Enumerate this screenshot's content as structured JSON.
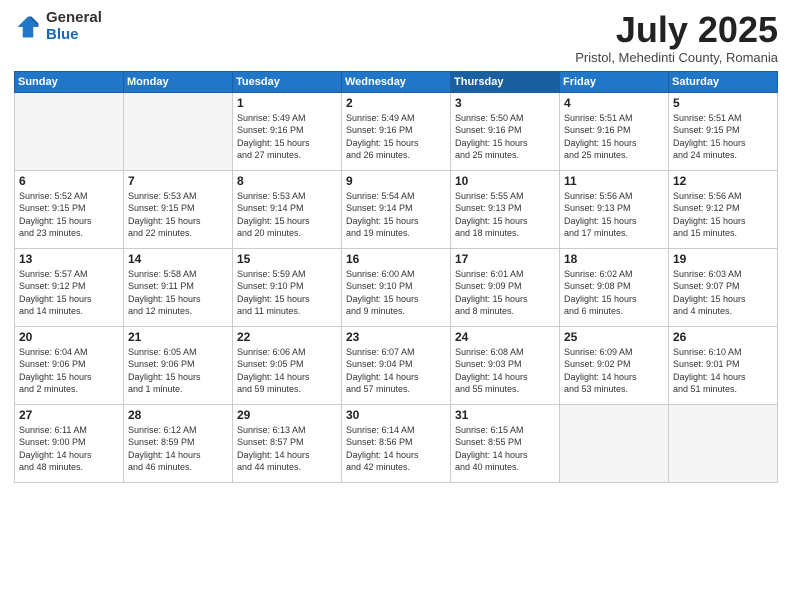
{
  "logo": {
    "general": "General",
    "blue": "Blue"
  },
  "header": {
    "month": "July 2025",
    "location": "Pristol, Mehedinti County, Romania"
  },
  "weekdays": [
    "Sunday",
    "Monday",
    "Tuesday",
    "Wednesday",
    "Thursday",
    "Friday",
    "Saturday"
  ],
  "weeks": [
    [
      {
        "day": "",
        "info": ""
      },
      {
        "day": "",
        "info": ""
      },
      {
        "day": "1",
        "info": "Sunrise: 5:49 AM\nSunset: 9:16 PM\nDaylight: 15 hours\nand 27 minutes."
      },
      {
        "day": "2",
        "info": "Sunrise: 5:49 AM\nSunset: 9:16 PM\nDaylight: 15 hours\nand 26 minutes."
      },
      {
        "day": "3",
        "info": "Sunrise: 5:50 AM\nSunset: 9:16 PM\nDaylight: 15 hours\nand 25 minutes."
      },
      {
        "day": "4",
        "info": "Sunrise: 5:51 AM\nSunset: 9:16 PM\nDaylight: 15 hours\nand 25 minutes."
      },
      {
        "day": "5",
        "info": "Sunrise: 5:51 AM\nSunset: 9:15 PM\nDaylight: 15 hours\nand 24 minutes."
      }
    ],
    [
      {
        "day": "6",
        "info": "Sunrise: 5:52 AM\nSunset: 9:15 PM\nDaylight: 15 hours\nand 23 minutes."
      },
      {
        "day": "7",
        "info": "Sunrise: 5:53 AM\nSunset: 9:15 PM\nDaylight: 15 hours\nand 22 minutes."
      },
      {
        "day": "8",
        "info": "Sunrise: 5:53 AM\nSunset: 9:14 PM\nDaylight: 15 hours\nand 20 minutes."
      },
      {
        "day": "9",
        "info": "Sunrise: 5:54 AM\nSunset: 9:14 PM\nDaylight: 15 hours\nand 19 minutes."
      },
      {
        "day": "10",
        "info": "Sunrise: 5:55 AM\nSunset: 9:13 PM\nDaylight: 15 hours\nand 18 minutes."
      },
      {
        "day": "11",
        "info": "Sunrise: 5:56 AM\nSunset: 9:13 PM\nDaylight: 15 hours\nand 17 minutes."
      },
      {
        "day": "12",
        "info": "Sunrise: 5:56 AM\nSunset: 9:12 PM\nDaylight: 15 hours\nand 15 minutes."
      }
    ],
    [
      {
        "day": "13",
        "info": "Sunrise: 5:57 AM\nSunset: 9:12 PM\nDaylight: 15 hours\nand 14 minutes."
      },
      {
        "day": "14",
        "info": "Sunrise: 5:58 AM\nSunset: 9:11 PM\nDaylight: 15 hours\nand 12 minutes."
      },
      {
        "day": "15",
        "info": "Sunrise: 5:59 AM\nSunset: 9:10 PM\nDaylight: 15 hours\nand 11 minutes."
      },
      {
        "day": "16",
        "info": "Sunrise: 6:00 AM\nSunset: 9:10 PM\nDaylight: 15 hours\nand 9 minutes."
      },
      {
        "day": "17",
        "info": "Sunrise: 6:01 AM\nSunset: 9:09 PM\nDaylight: 15 hours\nand 8 minutes."
      },
      {
        "day": "18",
        "info": "Sunrise: 6:02 AM\nSunset: 9:08 PM\nDaylight: 15 hours\nand 6 minutes."
      },
      {
        "day": "19",
        "info": "Sunrise: 6:03 AM\nSunset: 9:07 PM\nDaylight: 15 hours\nand 4 minutes."
      }
    ],
    [
      {
        "day": "20",
        "info": "Sunrise: 6:04 AM\nSunset: 9:06 PM\nDaylight: 15 hours\nand 2 minutes."
      },
      {
        "day": "21",
        "info": "Sunrise: 6:05 AM\nSunset: 9:06 PM\nDaylight: 15 hours\nand 1 minute."
      },
      {
        "day": "22",
        "info": "Sunrise: 6:06 AM\nSunset: 9:05 PM\nDaylight: 14 hours\nand 59 minutes."
      },
      {
        "day": "23",
        "info": "Sunrise: 6:07 AM\nSunset: 9:04 PM\nDaylight: 14 hours\nand 57 minutes."
      },
      {
        "day": "24",
        "info": "Sunrise: 6:08 AM\nSunset: 9:03 PM\nDaylight: 14 hours\nand 55 minutes."
      },
      {
        "day": "25",
        "info": "Sunrise: 6:09 AM\nSunset: 9:02 PM\nDaylight: 14 hours\nand 53 minutes."
      },
      {
        "day": "26",
        "info": "Sunrise: 6:10 AM\nSunset: 9:01 PM\nDaylight: 14 hours\nand 51 minutes."
      }
    ],
    [
      {
        "day": "27",
        "info": "Sunrise: 6:11 AM\nSunset: 9:00 PM\nDaylight: 14 hours\nand 48 minutes."
      },
      {
        "day": "28",
        "info": "Sunrise: 6:12 AM\nSunset: 8:59 PM\nDaylight: 14 hours\nand 46 minutes."
      },
      {
        "day": "29",
        "info": "Sunrise: 6:13 AM\nSunset: 8:57 PM\nDaylight: 14 hours\nand 44 minutes."
      },
      {
        "day": "30",
        "info": "Sunrise: 6:14 AM\nSunset: 8:56 PM\nDaylight: 14 hours\nand 42 minutes."
      },
      {
        "day": "31",
        "info": "Sunrise: 6:15 AM\nSunset: 8:55 PM\nDaylight: 14 hours\nand 40 minutes."
      },
      {
        "day": "",
        "info": ""
      },
      {
        "day": "",
        "info": ""
      }
    ]
  ]
}
